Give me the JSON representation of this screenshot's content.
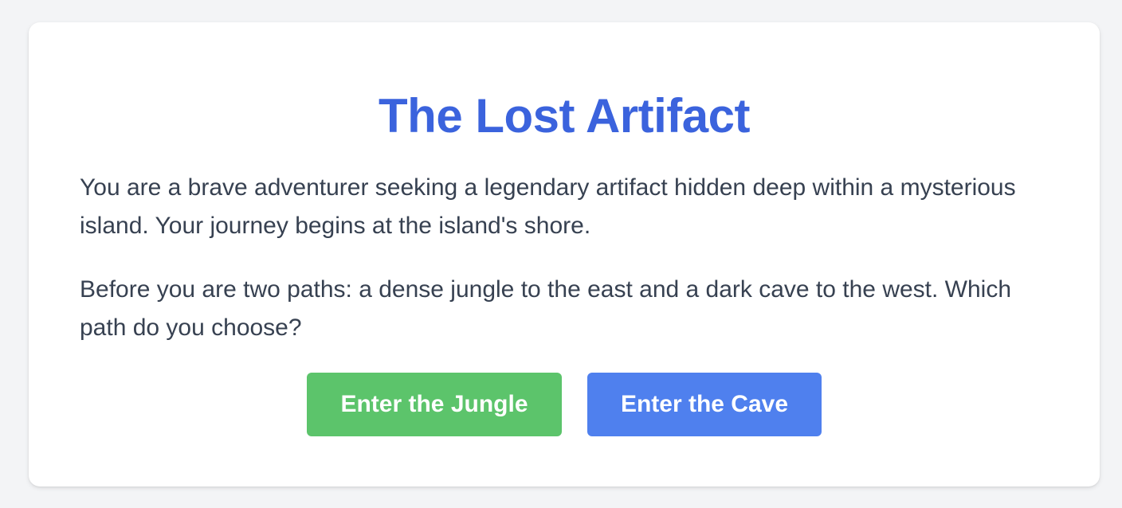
{
  "game": {
    "title": "The Lost Artifact",
    "paragraphs": [
      "You are a brave adventurer seeking a legendary artifact hidden deep within a mysterious island. Your journey begins at the island's shore.",
      "Before you are two paths: a dense jungle to the east and a dark cave to the west. Which path do you choose?"
    ],
    "choices": [
      {
        "label": "Enter the Jungle",
        "color": "#5cc46b"
      },
      {
        "label": "Enter the Cave",
        "color": "#4f80ee"
      }
    ]
  },
  "colors": {
    "background": "#f3f4f6",
    "card": "#ffffff",
    "title": "#3b63dd",
    "text": "#374151"
  }
}
